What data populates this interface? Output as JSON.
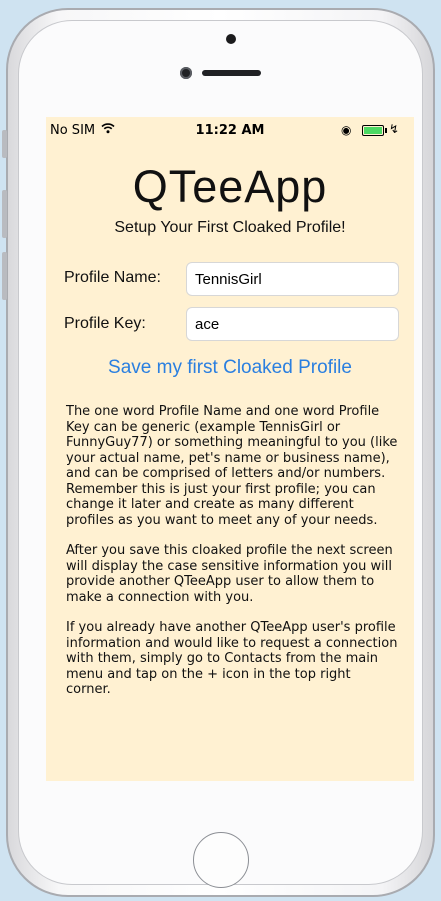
{
  "status_bar": {
    "carrier": "No SIM",
    "time": "11:22 AM",
    "wifi_icon": "wifi-icon",
    "orientation_lock_icon": "rotation-lock-icon",
    "battery_icon": "battery-charging-icon",
    "battery_color": "#4cd964"
  },
  "app": {
    "title": "QTeeApp",
    "subtitle": "Setup Your First Cloaked Profile!",
    "background_color": "#fff1d2",
    "accent_color": "#2a7fe0"
  },
  "form": {
    "profile_name_label": "Profile Name:",
    "profile_name_value": "TennisGirl",
    "profile_key_label": "Profile Key:",
    "profile_key_value": "ace",
    "save_label": "Save my first Cloaked Profile"
  },
  "info": {
    "paragraph_1": "The one word Profile Name and one word Profile Key can be generic (example TennisGirl or FunnyGuy77) or something meaningful to you (like your actual name, pet's name or business name), and can be comprised of letters and/or numbers. Remember this is just your first profile; you can change it later and create as many different profiles as you want to meet any of your needs.",
    "paragraph_2": "After you save this cloaked profile the next screen will display the case sensitive information you will provide another QTeeApp user to allow them to make a connection with you.",
    "paragraph_3": "If you already have another QTeeApp user's profile information and would like to request a connection with them, simply go to Contacts from the main menu and tap on the + icon in the top right corner."
  }
}
